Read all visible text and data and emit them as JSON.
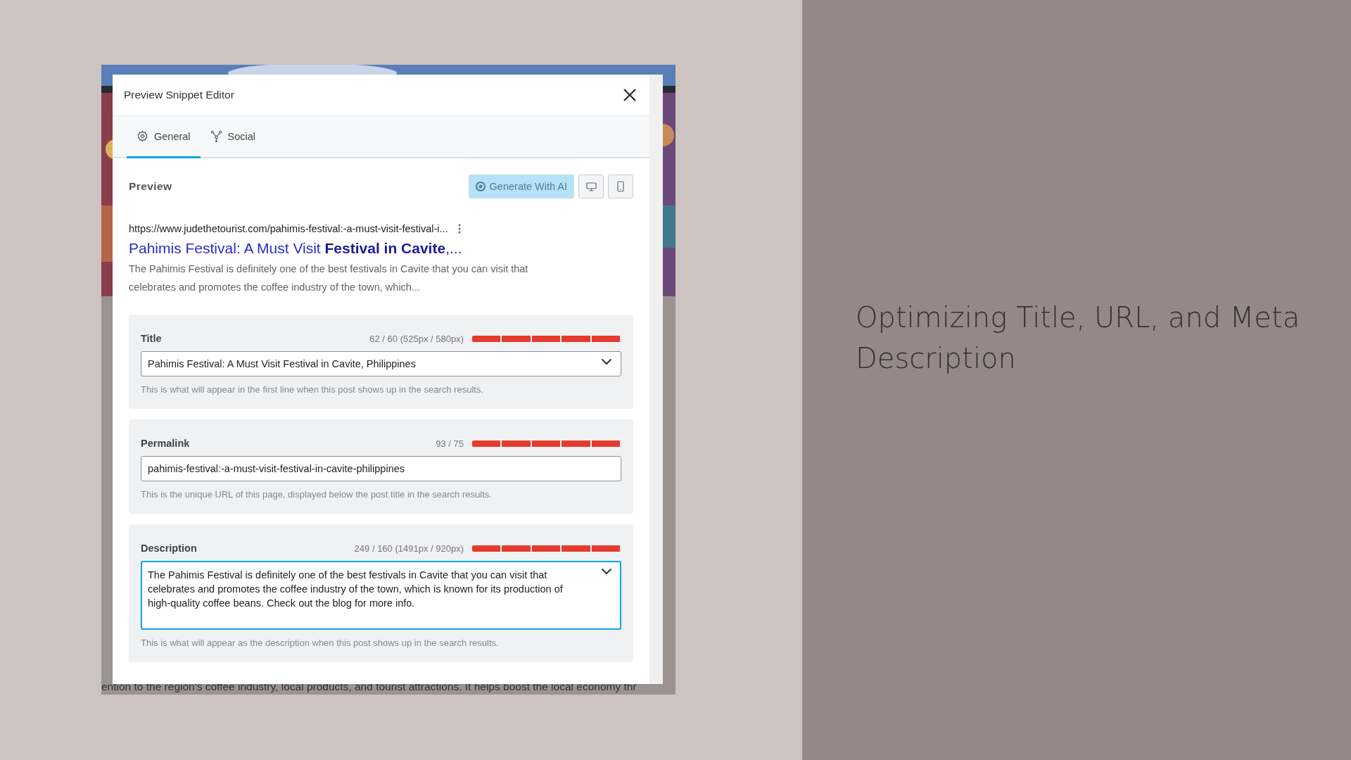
{
  "slide_heading": "Optimizing Title, URL, and Meta Description",
  "background_page": {
    "bottom_line": "ention to the region's coffee industry, local products, and tourist attractions. It helps boost the local economy thr"
  },
  "dialog": {
    "title": "Preview Snippet Editor",
    "tabs": [
      {
        "label": "General",
        "kind": "settings",
        "selected": true
      },
      {
        "label": "Social",
        "kind": "share",
        "selected": false
      }
    ],
    "preview": {
      "label": "Preview",
      "generate_button": {
        "label": "Generate With AI",
        "disabled": true
      },
      "devices": [
        {
          "kind": "desktop"
        },
        {
          "kind": "mobile"
        }
      ]
    },
    "snippet": {
      "url": "https://www.judethetourist.com/pahimis-festival:-a-must-visit-festival-i...",
      "title": "Pahimis Festival: A Must Visit **Festival in Cavite**,...",
      "description": "The Pahimis Festival is definitely one of the best festivals in Cavite that you can visit that celebrates and promotes the coffee industry of the town, which..."
    },
    "fields": [
      {
        "kind": "select",
        "label": "Title",
        "counter": "62 / 60 (525px / 580px)",
        "level": 1,
        "value": "Pahimis Festival: A Must Visit Festival in Cavite, Philippines",
        "focused": false,
        "help": "This is what will appear in the first line when this post shows up in the search results."
      },
      {
        "kind": "text",
        "label": "Permalink",
        "counter": "93 / 75",
        "level": 1,
        "value": "pahimis-festival:-a-must-visit-festival-in-cavite-philippines",
        "focused": false,
        "help": "This is the unique URL of this page, displayed below the post title in the search results."
      },
      {
        "kind": "textarea",
        "label": "Description",
        "counter": "249 / 160 (1491px / 920px)",
        "level": 1,
        "value": "The Pahimis Festival is definitely one of the best festivals in Cavite that you can visit that celebrates and promotes the coffee industry of the town, which is known for its production of high-quality coffee beans. Check out the blog for more info.",
        "focused": true,
        "help": "This is what will appear as the description when this post shows up in the search results."
      }
    ]
  }
}
